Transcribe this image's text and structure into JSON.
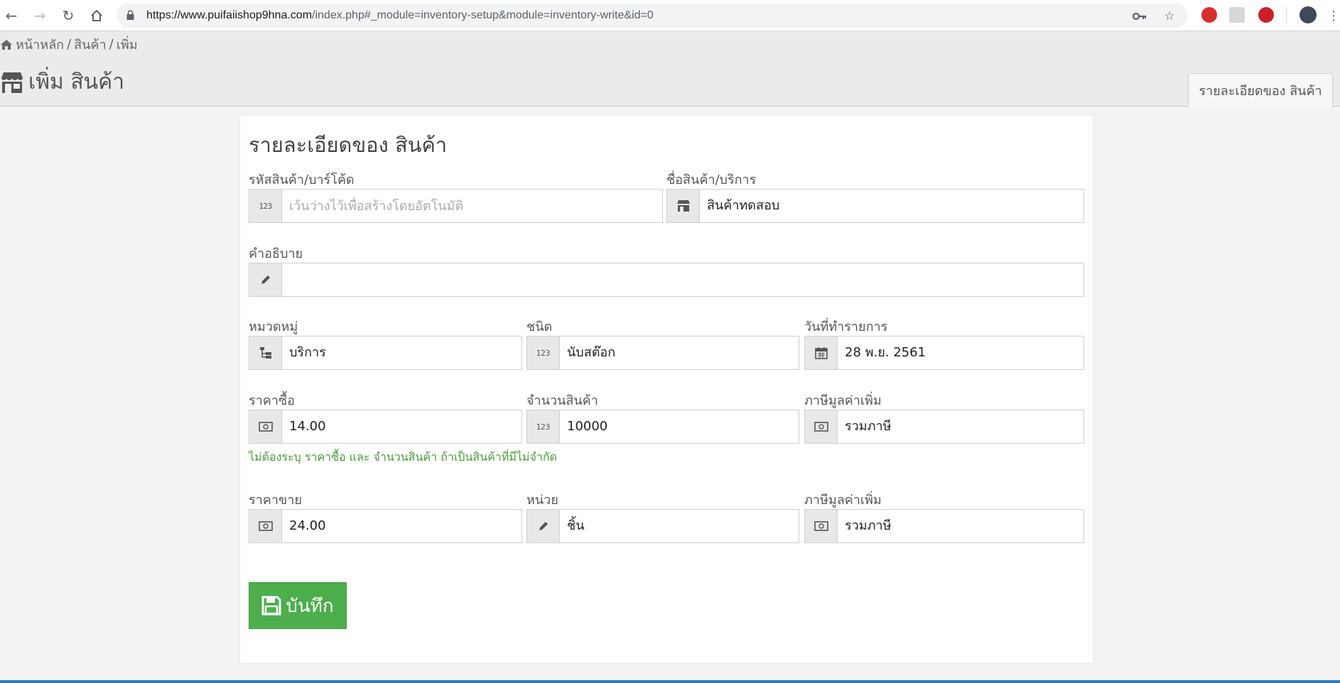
{
  "browser": {
    "url_host": "https://www.puifaiishop9hna.com",
    "url_path": "/index.php#_module=inventory-setup&module=inventory-write&id=0",
    "icons": [
      "back-icon",
      "forward-icon",
      "reload-icon",
      "home-icon",
      "lock-icon",
      "key-icon",
      "star-icon",
      "opera-extension-icon",
      "pdf-extension-icon",
      "pinterest-extension-icon",
      "profile-avatar",
      "menu-icon"
    ]
  },
  "breadcrumb": {
    "home": "หน้าหลัก",
    "sep1": "/",
    "section": "สินค้า",
    "sep2": "/",
    "current": "เพิ่ม"
  },
  "header": {
    "title": "เพิ่ม สินค้า",
    "tab_label": "รายละเอียดของ สินค้า"
  },
  "panel": {
    "title": "รายละเอียดของ สินค้า"
  },
  "form": {
    "product_code": {
      "label": "รหัสสินค้า/บาร์โค้ด",
      "value": "",
      "placeholder": "เว้นว่างไว้เพื่อสร้างโดยอัตโนมัติ",
      "icon": "numbers-icon"
    },
    "product_name": {
      "label": "ชื่อสินค้า/บริการ",
      "value": "สินค้าทดสอบ",
      "icon": "shop-icon"
    },
    "description": {
      "label": "คำอธิบาย",
      "value": "",
      "icon": "pencil-icon"
    },
    "category": {
      "label": "หมวดหมู่",
      "value": "บริการ",
      "icon": "tree-icon"
    },
    "type": {
      "label": "ชนิด",
      "value": "นับสต๊อก",
      "icon": "numbers-icon"
    },
    "date": {
      "label": "วันที่ทำรายการ",
      "value": "28 พ.ย. 2561",
      "icon": "calendar-icon"
    },
    "cost_price": {
      "label": "ราคาซื้อ",
      "value": "14.00",
      "icon": "money-icon"
    },
    "quantity": {
      "label": "จำนวนสินค้า",
      "value": "10000",
      "icon": "numbers-icon"
    },
    "vat_buy": {
      "label": "ภาษีมูลค่าเพิ่ม",
      "value": "รวมภาษี",
      "icon": "money-icon"
    },
    "hint": "ไม่ต้องระบุ ราคาซื้อ และ จำนวนสินค้า ถ้าเป็นสินค้าที่มีไม่จำกัด",
    "sell_price": {
      "label": "ราคาขาย",
      "value": "24.00",
      "icon": "money-icon"
    },
    "unit": {
      "label": "หน่วย",
      "value": "ชิ้น",
      "icon": "pencil-icon"
    },
    "vat_sell": {
      "label": "ภาษีมูลค่าเพิ่ม",
      "value": "รวมภาษี",
      "icon": "money-icon"
    },
    "save_label": "บันทึก"
  },
  "colors": {
    "save_button": "#4cae4c",
    "hint_text": "#4a9a3a",
    "accent_line": "#2a7bbf"
  }
}
